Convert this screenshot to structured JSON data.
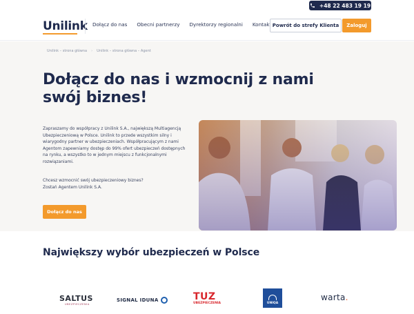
{
  "topbar": {
    "phone": "+48 22 483 19 19",
    "phone_icon": "phone-icon"
  },
  "header": {
    "logo": "Unilink",
    "nav": [
      "Dołącz do nas",
      "Obecni partnerzy",
      "Dyrektorzy regionalni",
      "Kontakt"
    ],
    "client_zone_button": "Powrót do strefy Klienta",
    "login_button": "Zaloguj"
  },
  "breadcrumb": [
    "Unilink – strona główna",
    "Unilink – strona główna – Agent"
  ],
  "hero": {
    "title": "Dołącz do nas i wzmocnij z nami swój biznes!",
    "paragraph1": "Zapraszamy do współpracy z Unilink S.A., największą Multiagencją Ubezpieczeniową w Polsce. Unilink to przede wszystkim silny i wiarygodny partner w ubezpieczeniach. Współpracującym z nami Agentom zapewniamy dostęp do 99% ofert ubezpieczeń dostępnych na rynku, a wszystko to w jednym miejscu z funkcjonalnymi rozwiązaniami.",
    "paragraph2_line1": "Chcesz wzmocnić swój ubezpieczeniowy biznes?",
    "paragraph2_line2": "Zostań Agentem Unilink S.A.",
    "cta": "Dołącz do nas"
  },
  "section": {
    "title": "Największy wybór ubezpieczeń w Polsce"
  },
  "partners": {
    "saltus": "SALTUS",
    "saltus_sub": "UBEZPIECZENIA",
    "signal": "SIGNAL IDUNA",
    "tuz": "TUZ",
    "tuz_sub": "UBEZPIECZENIA",
    "uniqa": "UNIQA",
    "warta": "warta",
    "warta_dot": "."
  },
  "colors": {
    "navy": "#1f2a4d",
    "accent": "#f39a2c",
    "hero_bg": "#f7f6f4"
  }
}
